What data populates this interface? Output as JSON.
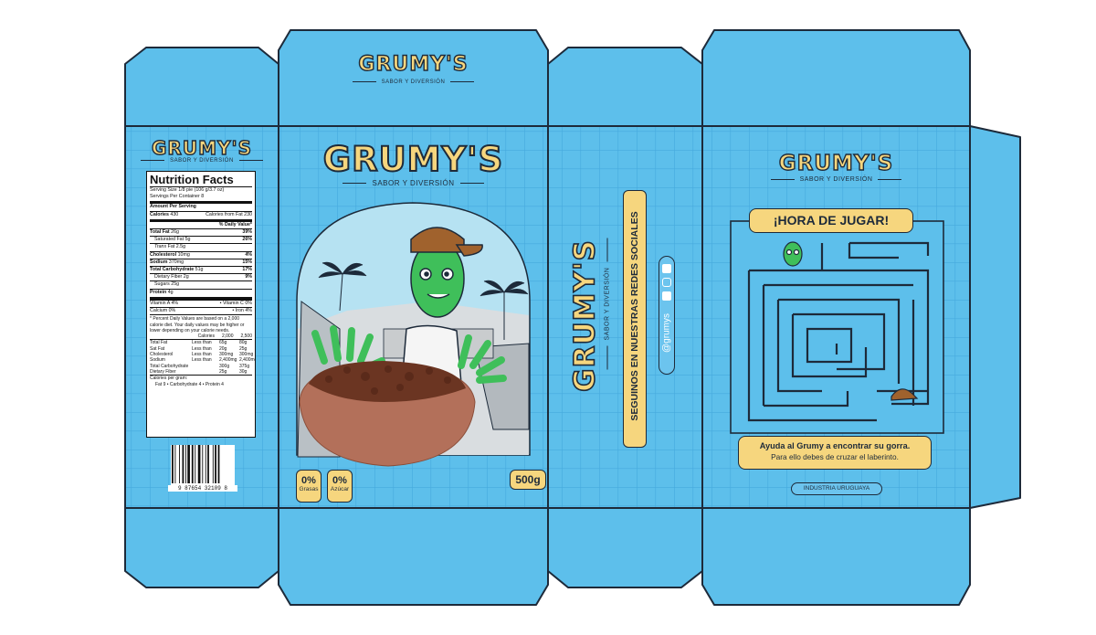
{
  "brand": {
    "name": "GRUMY'S",
    "tagline": "SABOR Y DIVERSIÓN"
  },
  "colors": {
    "box_blue": "#5DBFEB",
    "grid_line": "#45A9DD",
    "outline": "#1d2a3a",
    "accent_yellow": "#F6D67E",
    "character_green": "#3fbf5a"
  },
  "nutrition": {
    "title": "Nutrition Facts",
    "serving_size": "Serving Size   1/8 pie    (106 g/3.7 oz)",
    "servings": "Servings Per Container   8",
    "amount_per_serving": "Amount Per Serving",
    "calories_label": "Calories",
    "calories_value": "430",
    "calories_fat": "Calories from Fat 230",
    "dv_header": "% Daily Value*",
    "rows": [
      {
        "label": "Total Fat",
        "amount": "26g",
        "dv": "39%",
        "bold": true,
        "indent": false
      },
      {
        "label": "Saturated Fat",
        "amount": "5g",
        "dv": "26%",
        "bold": false,
        "indent": true
      },
      {
        "label": "Trans",
        "amount": "Fat 2.5g",
        "dv": "",
        "bold": false,
        "indent": true
      },
      {
        "label": "Cholesterol",
        "amount": "10mg",
        "dv": "4%",
        "bold": true,
        "indent": false
      },
      {
        "label": "Sodium",
        "amount": "370mg",
        "dv": "15%",
        "bold": true,
        "indent": false
      },
      {
        "label": "Total Carbohydrate",
        "amount": "51g",
        "dv": "17%",
        "bold": true,
        "indent": false
      },
      {
        "label": "Dietary Fiber",
        "amount": "2g",
        "dv": "9%",
        "bold": false,
        "indent": true
      },
      {
        "label": "Sugars",
        "amount": "25g",
        "dv": "",
        "bold": false,
        "indent": true
      },
      {
        "label": "Protein",
        "amount": "4g",
        "dv": "",
        "bold": true,
        "indent": false
      }
    ],
    "vitamins": [
      {
        "left": "Vitamin A  4%",
        "right": "Vitamin C 0%"
      },
      {
        "left": "Calcium  0%",
        "right": "Iron  4%"
      }
    ],
    "footnote": "* Percent Daily Values are based on a 2,000 calorie diet. Your daily values may be higher or lower depending on your calorie needs.",
    "table_header": [
      "Calories",
      "2,000",
      "2,500"
    ],
    "table_rows": [
      [
        "Total Fat",
        "Less than",
        "65g",
        "80g"
      ],
      [
        "Sat Fat",
        "Less than",
        "20g",
        "25g"
      ],
      [
        "Cholesterol",
        "Less than",
        "300mg",
        "300mg"
      ],
      [
        "Sodium",
        "Less than",
        "2,400mg",
        "2,400mg"
      ],
      [
        "Total Carbohydrate",
        "",
        "300g",
        "375g"
      ],
      [
        "Dietary Fiber",
        "",
        "25g",
        "30g"
      ]
    ],
    "per_gram_title": "Calories per gram:",
    "per_gram": "Fat 9   •   Carbohydrate 4   •   Protein 4"
  },
  "barcode_number": "9   87654   32109   8",
  "front": {
    "badge_fat_pct": "0%",
    "badge_fat_label": "Grasas",
    "badge_sugar_pct": "0%",
    "badge_sugar_label": "Azúcar",
    "weight": "500g"
  },
  "side": {
    "social_heading": "SEGUINOS EN NUESTRAS REDES SOCIALES",
    "handle": "@grumys",
    "icons": [
      "youtube-icon",
      "instagram-icon",
      "facebook-icon"
    ]
  },
  "back": {
    "game_title": "¡HORA DE JUGAR!",
    "instruction_main": "Ayuda al Grumy a encontrar su gorra.",
    "instruction_sub": "Para ello debes de cruzar el laberinto.",
    "origin": "INDUSTRIA URUGUAYA"
  }
}
